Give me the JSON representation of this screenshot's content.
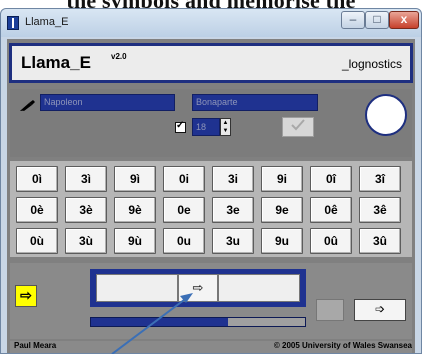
{
  "caption": {
    "text": "the symbols and memorise the"
  },
  "window": {
    "title": "Llama_E",
    "minimize": "–",
    "maximize": "□",
    "close": "x"
  },
  "header": {
    "app_name": "Llama_E",
    "version": "v2.0",
    "brand": "_lognostics"
  },
  "user": {
    "first_name": "Napoleon",
    "last_name": "Bonaparte",
    "age": "18",
    "confirm_icon": "tick-hand-icon"
  },
  "grid": {
    "rows": [
      [
        "0ì",
        "3ì",
        "9ì",
        "0i",
        "3i",
        "9i",
        "0î",
        "3î"
      ],
      [
        "0è",
        "3è",
        "9è",
        "0e",
        "3e",
        "9e",
        "0ê",
        "3ê"
      ],
      [
        "0ù",
        "3ù",
        "9ù",
        "0u",
        "3u",
        "9u",
        "0û",
        "3û"
      ]
    ]
  },
  "controls": {
    "yellow_arrow": "⇨",
    "play_arrow": "⇨",
    "next_arrow": "➩",
    "progress": 0.64
  },
  "status": {
    "author": "Paul Meara",
    "copyright": "© 2005 University of Wales Swansea"
  },
  "colors": {
    "accent": "#1f3290",
    "highlight": "#ffff00",
    "annotation": "#3b6fb6"
  }
}
